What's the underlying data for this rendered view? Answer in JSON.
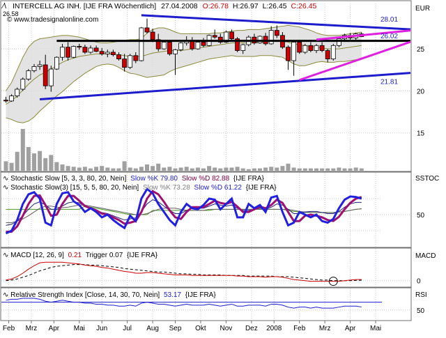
{
  "colors": {
    "background": "#ffffff",
    "panel_border": "#6f6f6f",
    "grid": "#c8c8c8",
    "candle_up": "#ffffff",
    "candle_down": "#cc0000",
    "band_fill": "#dcdcdc",
    "band_line": "#8a8a3a",
    "trend_blue": "#1c1ccc",
    "trend_magenta": "#e020e0",
    "volume": "#808080",
    "stoch_k": "#2020e0",
    "stoch_d": "#a01070",
    "stoch_green": "#4a9a20",
    "macd_line": "#cc0000",
    "macd_trigger": "#000000",
    "rsi": "#1c1ccc",
    "text": "#000000",
    "red_text": "#cc0000",
    "blue_text": "#1c1ccc",
    "gray_text": "#808080",
    "purple_text": "#800040"
  },
  "header": {
    "title": "INTERCELL AG INH. [IJE FRA  Wöchentlich]",
    "date": "27.04.2008",
    "open_label": "O:26.78",
    "high_label": "H:26.97",
    "low_label": "L:26.45",
    "close_label": "C:26.45",
    "watermark": "© www.tradesignalonline.com",
    "corner_value": "26.58"
  },
  "x_axis": {
    "labels": [
      "Feb",
      "Mrz",
      "Apr",
      "Mai",
      "Jun",
      "Jul",
      "Aug",
      "Sep",
      "Okt",
      "Nov",
      "Dez",
      "2008",
      "Feb",
      "Mrz",
      "Apr",
      "Mai"
    ],
    "positions": [
      0.5,
      4.5,
      8.5,
      13,
      17,
      21.5,
      26,
      30,
      34.5,
      39,
      43.5,
      47.5,
      52,
      56.5,
      61,
      65.5
    ]
  },
  "price_panel": {
    "unit_label": "EUR",
    "y_ticks": [
      15,
      20,
      25
    ],
    "ylim": [
      10.5,
      30.4
    ],
    "level_labels": [
      {
        "text": "28.01",
        "value": 28.01
      },
      {
        "text": "26.02",
        "value": 26.02
      },
      {
        "text": "21.81",
        "value": 21.81
      }
    ]
  },
  "stoch_panel": {
    "label": "SSTOC",
    "y_ticks": [
      50
    ],
    "ylim": [
      -10,
      110
    ],
    "legend1": {
      "prefix": "Stochastic Slow [5, 3, 3, 80, 20, Nein]",
      "k": "Slow %K 79.80",
      "d": "Slow %D 82.88",
      "suffix": "{IJE FRA}"
    },
    "legend2": {
      "prefix": "Stochastic Slow(3) [15, 5, 5, 80, 20, Nein]",
      "k": "Slow %K 73.28",
      "d": "Slow %D 61.22",
      "suffix": "{IJE FRA}"
    }
  },
  "macd_panel": {
    "label": "MACD",
    "y_ticks": [
      0
    ],
    "ylim": [
      -1,
      3.6
    ],
    "legend": {
      "prefix": "MACD [12, 26, 9]",
      "macd": "0.21",
      "trigger": "Trigger 0.07",
      "suffix": "{IJE FRA}"
    }
  },
  "rsi_panel": {
    "label": "RSI",
    "y_ticks": [
      50
    ],
    "ylim": [
      40,
      62
    ],
    "legend": {
      "prefix": "Relative Strength Index [Close, 14, 30, 70, Nein]",
      "value": "53.17",
      "suffix": "{IJE FRA}"
    }
  },
  "chart_data": {
    "type": "candlestick",
    "title": "INTERCELL AG INH. [IJE FRA  Wöchentlich]",
    "ohlc": [
      [
        18.9,
        19.3,
        18.6,
        18.8
      ],
      [
        18.8,
        19.6,
        18.7,
        19.4
      ],
      [
        19.4,
        20.4,
        19.2,
        20.2
      ],
      [
        20.2,
        21.6,
        20.0,
        21.4
      ],
      [
        21.4,
        22.6,
        21.2,
        22.4
      ],
      [
        22.4,
        23.2,
        22.2,
        22.9
      ],
      [
        22.9,
        23.6,
        22.5,
        23.1
      ],
      [
        23.1,
        24.3,
        20.2,
        20.6
      ],
      [
        20.6,
        23.0,
        19.9,
        22.6
      ],
      [
        22.6,
        24.1,
        22.5,
        24.0
      ],
      [
        24.0,
        25.6,
        23.6,
        25.2
      ],
      [
        25.2,
        25.8,
        23.6,
        24.0
      ],
      [
        24.0,
        25.4,
        23.9,
        25.3
      ],
      [
        25.3,
        25.6,
        24.9,
        25.2
      ],
      [
        25.2,
        25.5,
        24.4,
        24.6
      ],
      [
        24.6,
        25.4,
        24.4,
        25.1
      ],
      [
        25.1,
        25.4,
        24.6,
        24.7
      ],
      [
        24.7,
        25.1,
        24.2,
        24.4
      ],
      [
        24.4,
        24.9,
        24.0,
        24.6
      ],
      [
        24.6,
        24.9,
        24.1,
        24.3
      ],
      [
        24.3,
        24.6,
        23.6,
        23.8
      ],
      [
        23.8,
        24.4,
        22.3,
        22.8
      ],
      [
        22.8,
        24.4,
        22.6,
        24.2
      ],
      [
        24.2,
        24.6,
        23.3,
        23.6
      ],
      [
        23.6,
        27.6,
        23.5,
        27.5
      ],
      [
        27.5,
        28.6,
        26.8,
        27.0
      ],
      [
        27.0,
        27.4,
        25.8,
        26.1
      ],
      [
        26.1,
        26.8,
        24.7,
        25.0
      ],
      [
        25.0,
        26.0,
        24.9,
        25.8
      ],
      [
        25.8,
        26.0,
        24.2,
        24.4
      ],
      [
        24.4,
        25.0,
        21.9,
        24.9
      ],
      [
        24.9,
        25.8,
        24.7,
        25.7
      ],
      [
        25.7,
        26.5,
        25.4,
        26.0
      ],
      [
        26.0,
        26.4,
        24.8,
        25.0
      ],
      [
        25.0,
        25.9,
        24.9,
        25.8
      ],
      [
        25.8,
        26.3,
        25.2,
        25.4
      ],
      [
        25.4,
        26.7,
        25.3,
        26.6
      ],
      [
        26.6,
        27.3,
        26.2,
        26.4
      ],
      [
        26.4,
        26.8,
        25.6,
        25.8
      ],
      [
        25.8,
        27.2,
        25.7,
        27.0
      ],
      [
        27.0,
        27.3,
        26.0,
        26.2
      ],
      [
        26.2,
        26.4,
        24.6,
        24.8
      ],
      [
        24.8,
        25.6,
        24.4,
        25.5
      ],
      [
        25.5,
        26.6,
        25.3,
        26.4
      ],
      [
        26.4,
        26.8,
        25.5,
        25.7
      ],
      [
        25.7,
        26.6,
        25.6,
        26.5
      ],
      [
        26.5,
        26.9,
        25.4,
        25.6
      ],
      [
        25.6,
        27.7,
        25.5,
        27.2
      ],
      [
        27.2,
        27.8,
        26.3,
        26.6
      ],
      [
        26.6,
        27.0,
        25.0,
        25.2
      ],
      [
        25.2,
        25.4,
        22.5,
        23.6
      ],
      [
        23.6,
        26.0,
        21.8,
        25.8
      ],
      [
        25.8,
        26.0,
        24.4,
        24.6
      ],
      [
        24.6,
        25.6,
        24.4,
        25.4
      ],
      [
        25.4,
        25.8,
        24.6,
        24.8
      ],
      [
        24.8,
        25.6,
        24.5,
        25.4
      ],
      [
        25.4,
        25.8,
        24.6,
        24.8
      ],
      [
        24.8,
        25.0,
        23.4,
        23.8
      ],
      [
        23.8,
        25.6,
        23.6,
        25.4
      ],
      [
        25.4,
        26.4,
        25.2,
        26.2
      ],
      [
        26.2,
        26.8,
        25.9,
        26.6
      ],
      [
        26.6,
        26.9,
        26.1,
        26.3
      ],
      [
        26.3,
        26.9,
        26.0,
        26.78
      ],
      [
        26.78,
        26.97,
        26.45,
        26.45
      ]
    ],
    "volume": [
      1.2,
      1.0,
      2.4,
      5.3,
      3.0,
      2.2,
      2.5,
      1.6,
      2.0,
      1.1,
      0.8,
      0.6,
      0.5,
      0.4,
      0.5,
      0.3,
      0.5,
      0.6,
      0.4,
      0.3,
      0.3,
      1.2,
      0.4,
      0.3,
      0.5,
      0.8,
      0.6,
      0.9,
      0.4,
      0.5,
      0.3,
      0.4,
      0.5,
      0.3,
      0.4,
      0.3,
      0.6,
      0.4,
      0.3,
      0.4,
      0.4,
      0.5,
      0.3,
      0.2,
      0.3,
      0.3,
      0.4,
      0.5,
      0.4,
      0.6,
      0.9,
      0.4,
      0.3,
      0.3,
      0.3,
      0.3,
      0.3,
      0.3,
      0.3,
      0.4,
      0.3,
      0.3,
      0.4,
      0.3
    ],
    "bollinger_upper": [
      20.0,
      21.0,
      22.5,
      24.0,
      25.2,
      25.9,
      26.2,
      26.3,
      26.4,
      26.5,
      26.6,
      26.6,
      26.5,
      26.4,
      26.2,
      26.0,
      25.8,
      25.7,
      25.7,
      25.8,
      25.9,
      26.0,
      26.1,
      26.1,
      26.2,
      26.9,
      27.3,
      27.5,
      27.5,
      27.3,
      27.0,
      26.8,
      26.8,
      26.8,
      26.8,
      26.8,
      26.8,
      26.9,
      26.9,
      27.0,
      27.1,
      27.2,
      27.2,
      27.3,
      27.3,
      27.3,
      27.4,
      27.5,
      27.6,
      27.7,
      27.8,
      27.7,
      27.6,
      27.4,
      27.2,
      26.9,
      26.7,
      26.6,
      26.6,
      26.6,
      26.7,
      26.8,
      26.9,
      27.0
    ],
    "bollinger_middle": [
      18.4,
      18.8,
      19.4,
      20.1,
      20.8,
      21.4,
      21.9,
      22.2,
      22.6,
      23.0,
      23.4,
      23.7,
      23.9,
      24.1,
      24.2,
      24.3,
      24.4,
      24.4,
      24.4,
      24.4,
      24.3,
      24.2,
      24.1,
      24.1,
      24.1,
      24.3,
      24.5,
      24.6,
      24.7,
      24.8,
      24.8,
      24.8,
      24.9,
      25.0,
      25.1,
      25.2,
      25.3,
      25.4,
      25.5,
      25.6,
      25.7,
      25.7,
      25.7,
      25.7,
      25.7,
      25.8,
      25.8,
      25.9,
      25.9,
      25.9,
      25.8,
      25.6,
      25.5,
      25.4,
      25.3,
      25.2,
      25.1,
      25.0,
      25.0,
      25.0,
      25.1,
      25.2,
      25.3,
      25.4
    ],
    "bollinger_lower": [
      16.8,
      16.6,
      16.3,
      16.2,
      16.4,
      16.9,
      17.6,
      18.2,
      18.8,
      19.4,
      19.9,
      20.5,
      21.1,
      21.6,
      22.1,
      22.5,
      22.9,
      23.1,
      23.2,
      23.1,
      22.8,
      22.4,
      22.1,
      22.0,
      21.8,
      21.6,
      21.7,
      21.8,
      21.9,
      22.3,
      22.6,
      22.8,
      23.0,
      23.2,
      23.4,
      23.6,
      23.8,
      23.9,
      24.0,
      24.1,
      24.2,
      24.1,
      24.1,
      24.1,
      24.1,
      24.2,
      24.2,
      24.2,
      24.1,
      24.0,
      23.6,
      23.2,
      23.0,
      23.0,
      23.2,
      23.4,
      23.5,
      23.4,
      23.4,
      23.5,
      23.5,
      23.6,
      23.7,
      23.8
    ],
    "trendlines": [
      {
        "color_key": "trend_blue",
        "from": [
          6,
          19.0
        ],
        "to": [
          75,
          22.3
        ]
      },
      {
        "color_key": "trend_blue",
        "from": [
          24,
          29.0
        ],
        "to": [
          75,
          27.2
        ]
      },
      {
        "color_key": "text",
        "from": [
          9,
          25.95
        ],
        "to": [
          75,
          25.95
        ]
      },
      {
        "color_key": "trend_magenta",
        "from": [
          52,
          21.3
        ],
        "to": [
          75,
          26.6
        ]
      },
      {
        "color_key": "trend_magenta",
        "from": [
          55,
          26.1
        ],
        "to": [
          75,
          27.4
        ]
      }
    ],
    "stoch_fast_k": [
      15,
      20,
      40,
      70,
      88,
      92,
      80,
      35,
      30,
      70,
      90,
      92,
      75,
      68,
      55,
      62,
      55,
      45,
      50,
      40,
      32,
      25,
      48,
      38,
      80,
      98,
      90,
      70,
      55,
      40,
      30,
      55,
      70,
      62,
      60,
      68,
      80,
      78,
      60,
      70,
      80,
      45,
      45,
      70,
      62,
      68,
      55,
      82,
      85,
      55,
      30,
      35,
      55,
      50,
      45,
      50,
      38,
      35,
      42,
      62,
      78,
      84,
      83,
      80
    ],
    "stoch_slow_d": [
      18,
      18,
      28,
      48,
      70,
      85,
      86,
      68,
      48,
      50,
      70,
      85,
      85,
      76,
      66,
      62,
      58,
      52,
      50,
      45,
      40,
      33,
      35,
      38,
      55,
      80,
      94,
      88,
      74,
      58,
      45,
      42,
      55,
      64,
      64,
      64,
      70,
      76,
      72,
      70,
      74,
      65,
      55,
      55,
      60,
      65,
      62,
      68,
      78,
      72,
      55,
      38,
      38,
      48,
      50,
      48,
      45,
      40,
      38,
      46,
      60,
      72,
      80,
      83
    ],
    "stoch_slow3_k": [
      30,
      32,
      38,
      48,
      60,
      70,
      74,
      68,
      60,
      60,
      66,
      72,
      74,
      72,
      66,
      62,
      58,
      54,
      52,
      48,
      44,
      40,
      42,
      44,
      56,
      70,
      78,
      74,
      66,
      58,
      52,
      52,
      58,
      62,
      62,
      62,
      66,
      70,
      68,
      66,
      68,
      62,
      58,
      58,
      60,
      62,
      60,
      64,
      70,
      68,
      60,
      52,
      52,
      55,
      56,
      56,
      54,
      52,
      52,
      56,
      64,
      70,
      73,
      73
    ],
    "stoch_slow3_d": [
      35,
      35,
      38,
      42,
      48,
      55,
      62,
      66,
      66,
      64,
      63,
      64,
      66,
      68,
      68,
      66,
      64,
      62,
      60,
      58,
      56,
      54,
      52,
      50,
      50,
      52,
      56,
      60,
      62,
      62,
      62,
      60,
      58,
      58,
      58,
      58,
      60,
      60,
      60,
      60,
      60,
      60,
      60,
      60,
      60,
      60,
      60,
      60,
      60,
      60,
      60,
      58,
      56,
      55,
      54,
      54,
      54,
      54,
      54,
      55,
      56,
      58,
      60,
      61
    ],
    "stoch_green": [
      60,
      60,
      60,
      60,
      60,
      60,
      60,
      60,
      60,
      60,
      60,
      60,
      60,
      60,
      66,
      64,
      62,
      60,
      58,
      56,
      54,
      52,
      50,
      50,
      50,
      50,
      58,
      58,
      58,
      58,
      58,
      58,
      58,
      58,
      58,
      58,
      58,
      60,
      60,
      60,
      60,
      60,
      60,
      60,
      60,
      60,
      60,
      60,
      60,
      60,
      58,
      56,
      55,
      54,
      54,
      54,
      54,
      54,
      54,
      55,
      56,
      58,
      60,
      61
    ],
    "macd": [
      0.1,
      0.3,
      0.7,
      1.3,
      2.0,
      2.6,
      3.1,
      3.2,
      3.2,
      3.2,
      3.2,
      3.1,
      3.0,
      2.9,
      2.7,
      2.6,
      2.5,
      2.3,
      2.2,
      2.0,
      1.8,
      1.6,
      1.5,
      1.3,
      1.3,
      1.4,
      1.4,
      1.3,
      1.2,
      1.1,
      1.0,
      1.0,
      1.0,
      0.9,
      0.9,
      0.9,
      0.9,
      0.9,
      0.9,
      0.9,
      0.9,
      0.8,
      0.8,
      0.7,
      0.7,
      0.7,
      0.6,
      0.7,
      0.7,
      0.6,
      0.4,
      0.2,
      0.1,
      0.0,
      -0.1,
      -0.1,
      -0.1,
      -0.1,
      -0.1,
      -0.1,
      0.0,
      0.1,
      0.2,
      0.21
    ],
    "macd_trigger": [
      0.0,
      0.1,
      0.3,
      0.6,
      0.9,
      1.3,
      1.7,
      2.0,
      2.3,
      2.5,
      2.6,
      2.7,
      2.8,
      2.8,
      2.8,
      2.7,
      2.7,
      2.6,
      2.5,
      2.4,
      2.3,
      2.1,
      2.0,
      1.9,
      1.8,
      1.7,
      1.6,
      1.5,
      1.5,
      1.4,
      1.3,
      1.2,
      1.2,
      1.1,
      1.1,
      1.0,
      1.0,
      1.0,
      1.0,
      0.9,
      0.9,
      0.9,
      0.9,
      0.8,
      0.8,
      0.8,
      0.8,
      0.8,
      0.7,
      0.7,
      0.7,
      0.6,
      0.5,
      0.4,
      0.3,
      0.2,
      0.1,
      0.1,
      0.0,
      0.0,
      0.0,
      0.0,
      0.05,
      0.07
    ],
    "rsi": [
      60,
      61,
      61,
      62,
      62,
      62,
      61,
      59,
      58,
      59,
      60,
      59,
      58,
      58,
      57,
      57,
      56,
      56,
      55,
      55,
      54,
      54,
      55,
      54,
      57,
      58,
      57,
      56,
      56,
      55,
      54,
      55,
      56,
      55,
      55,
      55,
      56,
      55,
      54,
      55,
      56,
      54,
      54,
      55,
      55,
      55,
      54,
      56,
      56,
      55,
      53,
      52,
      53,
      53,
      52,
      53,
      52,
      52,
      52,
      53,
      54,
      54,
      54,
      53.17
    ],
    "highlight_circle": {
      "index": 58,
      "value": -0.1
    }
  }
}
